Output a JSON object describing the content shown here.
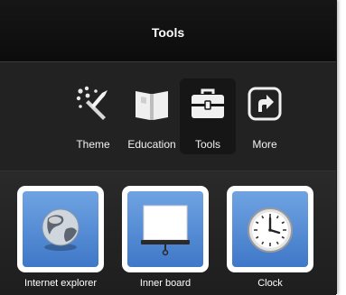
{
  "header": {
    "title": "Tools"
  },
  "categories": [
    {
      "label": "Theme",
      "icon": "paintbrush-icon",
      "active": false
    },
    {
      "label": "Education",
      "icon": "book-icon",
      "active": false
    },
    {
      "label": "Tools",
      "icon": "toolbox-icon",
      "active": true
    },
    {
      "label": "More",
      "icon": "shortcut-arrow-icon",
      "active": false
    }
  ],
  "apps": [
    {
      "label": "Internet explorer",
      "icon": "globe-icon"
    },
    {
      "label": "Inner board",
      "icon": "projector-screen-icon"
    },
    {
      "label": "Clock",
      "icon": "clock-icon"
    }
  ],
  "colors": {
    "panel_bg": "#262626",
    "header_bg": "#0c0c0c",
    "tile_bg": "#4a86d4",
    "active_cat_bg": "#161616"
  }
}
